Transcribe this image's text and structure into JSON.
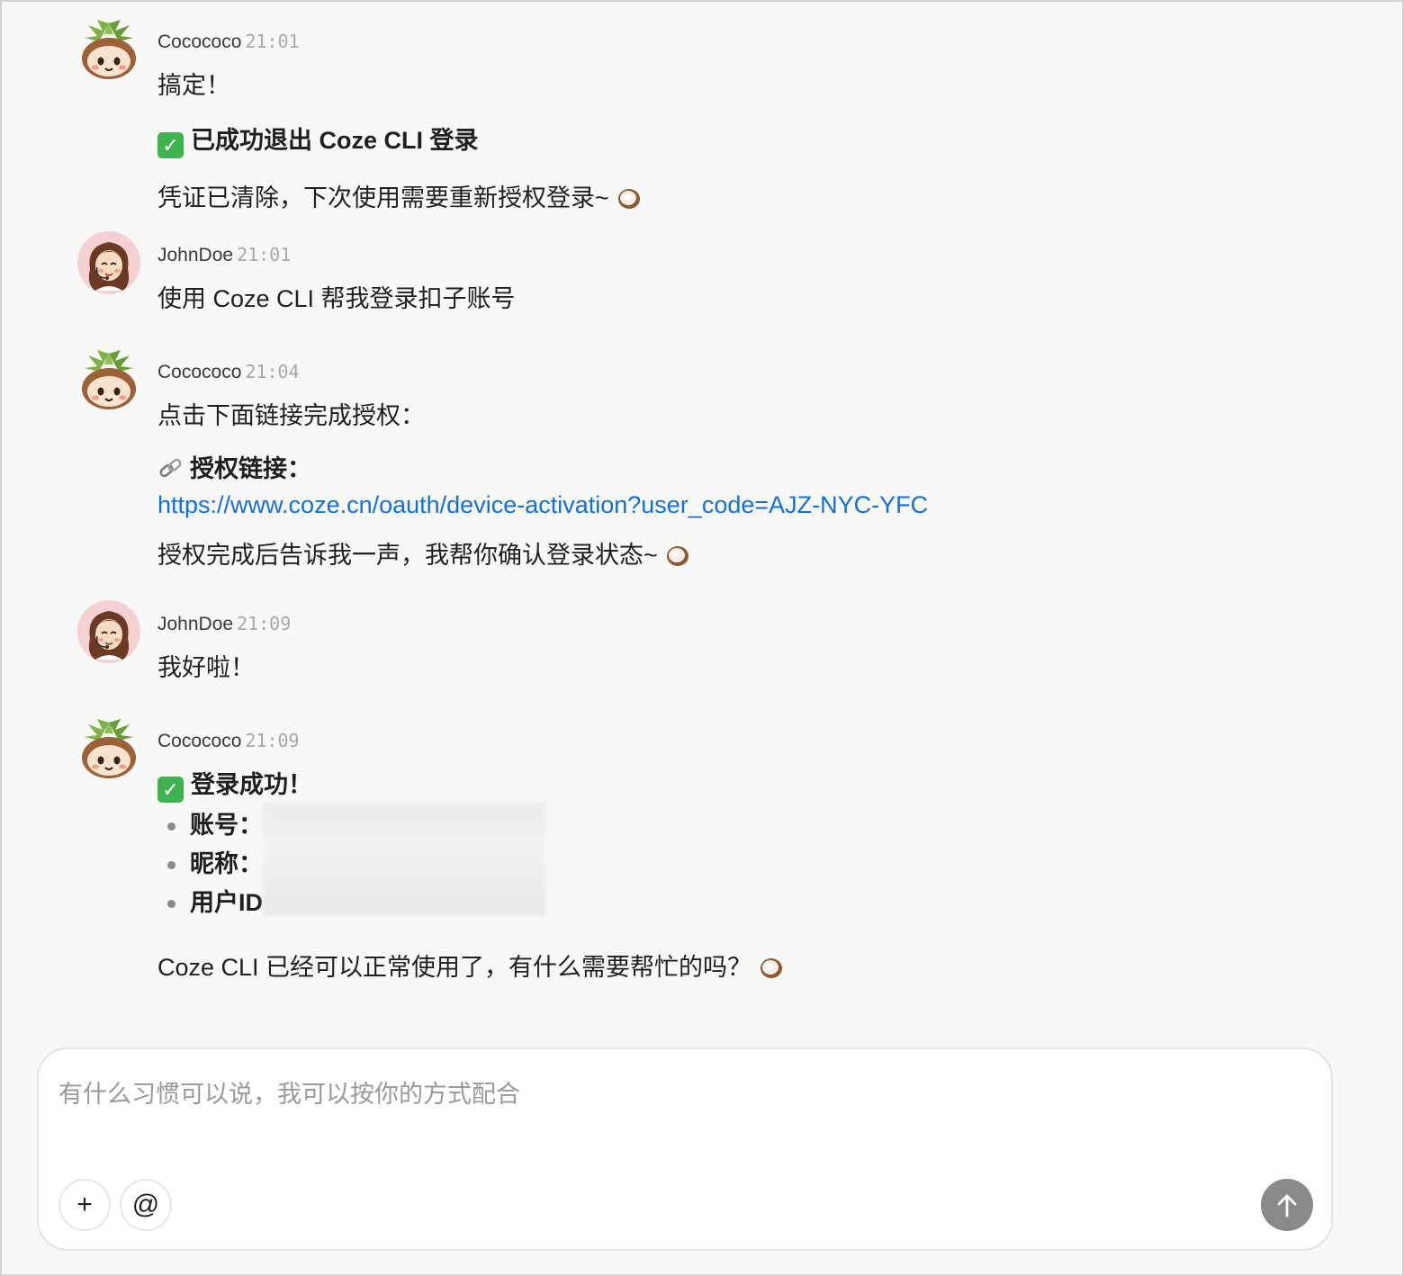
{
  "messages": [
    {
      "sender": "Cocococo",
      "time": "21:01",
      "avatar": "coconut-avatar",
      "lines": [
        "搞定！",
        "已成功退出 Coze CLI 登录",
        "凭证已清除，下次使用需要重新授权登录~"
      ]
    },
    {
      "sender": "JohnDoe",
      "time": "21:01",
      "avatar": "girl-avatar",
      "lines": [
        "使用 Coze CLI 帮我登录扣子账号"
      ]
    },
    {
      "sender": "Cocococo",
      "time": "21:04",
      "avatar": "coconut-avatar",
      "lines": [
        "点击下面链接完成授权：",
        "授权链接：",
        "https://www.coze.cn/oauth/device-activation?user_code=AJZ-NYC-YFC",
        "授权完成后告诉我一声，我帮你确认登录状态~"
      ]
    },
    {
      "sender": "JohnDoe",
      "time": "21:09",
      "avatar": "girl-avatar",
      "lines": [
        "我好啦！"
      ]
    },
    {
      "sender": "Cocococo",
      "time": "21:09",
      "avatar": "coconut-avatar",
      "lines": [
        "登录成功！"
      ],
      "bullets": [
        "账号：",
        "昵称：",
        "用户ID"
      ],
      "footer": "Coze CLI 已经可以正常使用了，有什么需要帮忙的吗？"
    }
  ],
  "composer": {
    "placeholder": "有什么习惯可以说，我可以按你的方式配合",
    "add_label": "+",
    "mention_label": "@",
    "send_icon": "arrow-up-icon"
  },
  "colors": {
    "link": "#1570d4",
    "check": "#3fb34f",
    "send": "#8a8a8a"
  }
}
